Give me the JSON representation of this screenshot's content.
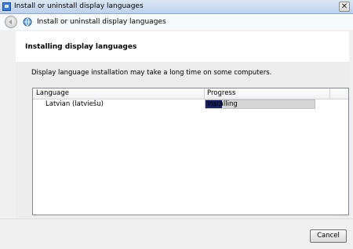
{
  "window": {
    "title": "Install or uninstall display languages",
    "close_glyph": "✕",
    "icons": {
      "app": "app-window-icon",
      "close": "close-icon"
    }
  },
  "header": {
    "title": "Install or uninstall display languages",
    "icons": {
      "back": "back-arrow-icon",
      "wizard": "language-wizard-icon"
    }
  },
  "main": {
    "heading": "Installing display languages",
    "description": "Display language installation may take a long time on some computers.",
    "list": {
      "columns": [
        "Language",
        "Progress"
      ],
      "rows": [
        {
          "language": "Latvian (latviešu)",
          "status": "Installing",
          "progress_fraction": 0.15
        }
      ]
    }
  },
  "footer": {
    "cancel_label": "Cancel"
  },
  "colors": {
    "progress_fill": "#15205a",
    "titlebar": "#c9dbf1"
  }
}
